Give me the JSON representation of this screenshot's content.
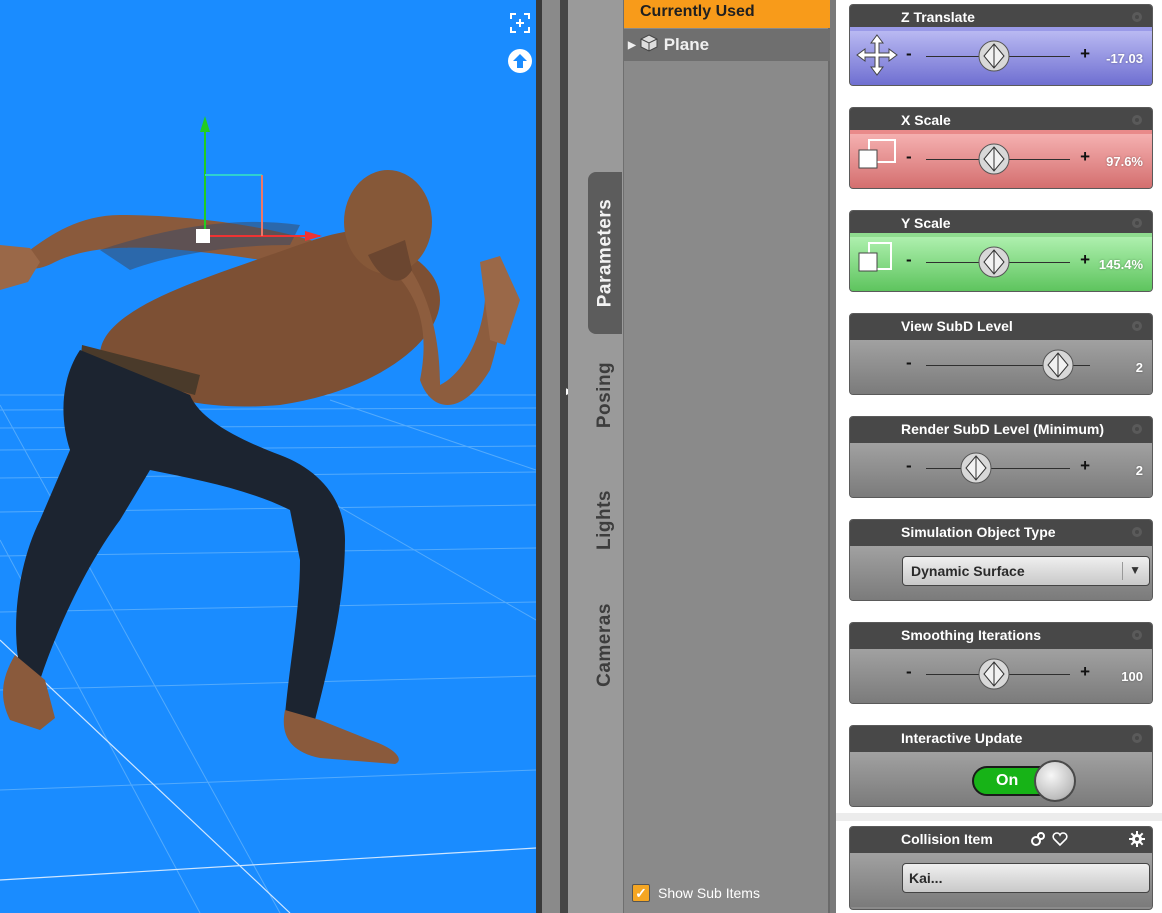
{
  "viewport": {
    "background_color": "#1a8cff",
    "frame_button_icon": "frame-selection-icon",
    "orbit_button_icon": "orbit-up-icon"
  },
  "tabs": [
    {
      "label": "Parameters",
      "active": true
    },
    {
      "label": "Posing",
      "active": false
    },
    {
      "label": "Lights",
      "active": false
    },
    {
      "label": "Cameras",
      "active": false
    }
  ],
  "scene_list": {
    "currently_used": "Currently Used",
    "items": [
      {
        "label": "Plane",
        "icon": "cube-icon"
      }
    ],
    "show_sub_items": {
      "label": "Show Sub Items",
      "checked": true
    }
  },
  "parameters": {
    "z_translate": {
      "label": "Z Translate",
      "value": "-17.03",
      "slider_fraction": 0.47,
      "color": "#8e8ee6"
    },
    "x_scale": {
      "label": "X Scale",
      "value": "97.6%",
      "slider_fraction": 0.47,
      "color": "#e88a8a"
    },
    "y_scale": {
      "label": "Y Scale",
      "value": "145.4%",
      "slider_fraction": 0.47,
      "color": "#7fd87f"
    },
    "view_subd": {
      "label": "View SubD Level",
      "value": "2",
      "slider_fraction": 0.92
    },
    "render_subd": {
      "label": "Render SubD Level (Minimum)",
      "value": "2",
      "slider_fraction": 0.35
    },
    "sim_object_type": {
      "label": "Simulation Object Type",
      "selected": "Dynamic Surface"
    },
    "smoothing_iterations": {
      "label": "Smoothing Iterations",
      "value": "100",
      "slider_fraction": 0.47
    },
    "interactive_update": {
      "label": "Interactive Update",
      "state": "On"
    },
    "collision_item": {
      "label": "Collision Item",
      "value": "Kai..."
    }
  }
}
